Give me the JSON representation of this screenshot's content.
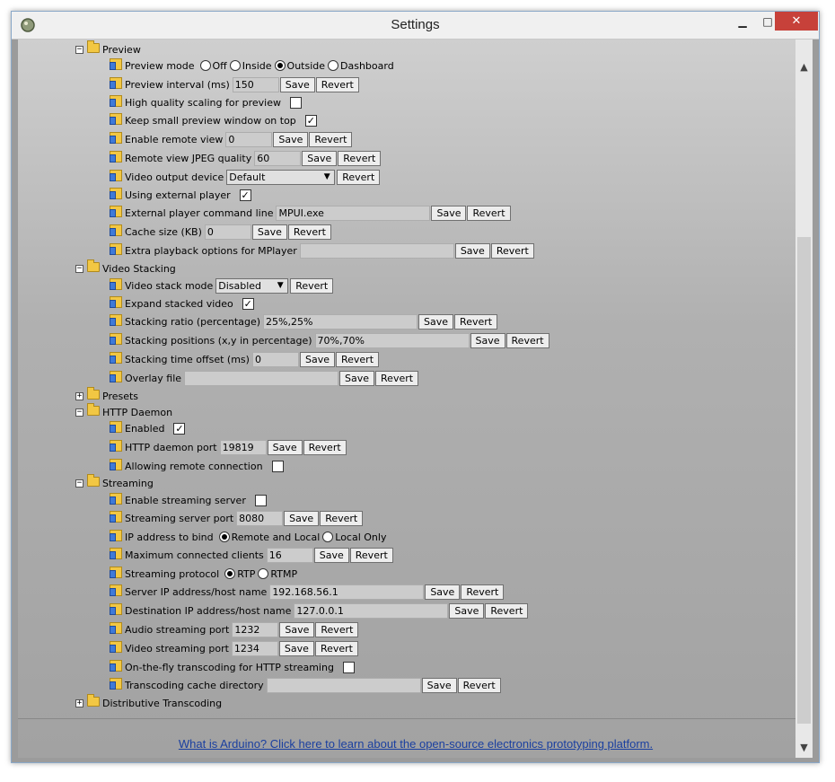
{
  "window": {
    "title": "Settings"
  },
  "sections": {
    "preview": {
      "label": "Preview",
      "preview_mode": {
        "label": "Preview mode",
        "options": [
          "Off",
          "Inside",
          "Outside",
          "Dashboard"
        ],
        "selected": "Outside"
      },
      "preview_interval": {
        "label": "Preview interval (ms)",
        "value": "150"
      },
      "high_quality_scaling": {
        "label": "High quality scaling for preview",
        "checked": false
      },
      "keep_small_preview": {
        "label": "Keep small preview window on top",
        "checked": true
      },
      "enable_remote_view": {
        "label": "Enable remote view",
        "value": "0"
      },
      "remote_view_jpeg": {
        "label": "Remote view JPEG quality",
        "value": "60"
      },
      "video_output_device": {
        "label": "Video output device",
        "value": "Default"
      },
      "using_external_player": {
        "label": "Using external player",
        "checked": true
      },
      "external_player_command": {
        "label": "External player command line",
        "value": "MPUI.exe"
      },
      "cache_size": {
        "label": "Cache size (KB)",
        "value": "0"
      },
      "extra_playback_options": {
        "label": "Extra playback options for MPlayer",
        "value": ""
      }
    },
    "video_stacking": {
      "label": "Video Stacking",
      "video_stack_mode": {
        "label": "Video stack mode",
        "value": "Disabled"
      },
      "expand_stacked_video": {
        "label": "Expand stacked video",
        "checked": true
      },
      "stacking_ratio": {
        "label": "Stacking ratio (percentage)",
        "value": "25%,25%"
      },
      "stacking_positions": {
        "label": "Stacking positions (x,y in percentage)",
        "value": "70%,70%"
      },
      "stacking_time_offset": {
        "label": "Stacking time offset (ms)",
        "value": "0"
      },
      "overlay_file": {
        "label": "Overlay file",
        "value": ""
      }
    },
    "presets": {
      "label": "Presets"
    },
    "http_daemon": {
      "label": "HTTP Daemon",
      "enabled": {
        "label": "Enabled",
        "checked": true
      },
      "http_daemon_port": {
        "label": "HTTP daemon port",
        "value": "19819"
      },
      "allowing_remote_connection": {
        "label": "Allowing remote connection",
        "checked": false
      }
    },
    "streaming": {
      "label": "Streaming",
      "enable_streaming_server": {
        "label": "Enable streaming server",
        "checked": false
      },
      "streaming_server_port": {
        "label": "Streaming server port",
        "value": "8080"
      },
      "ip_address_to_bind": {
        "label": "IP address to bind",
        "options": [
          "Remote and Local",
          "Local Only"
        ],
        "selected": "Remote and Local"
      },
      "maximum_connected_clients": {
        "label": "Maximum connected clients",
        "value": "16"
      },
      "streaming_protocol": {
        "label": "Streaming protocol",
        "options": [
          "RTP",
          "RTMP"
        ],
        "selected": "RTP"
      },
      "server_ip": {
        "label": "Server IP address/host name",
        "value": "192.168.56.1"
      },
      "destination_ip": {
        "label": "Destination IP address/host name",
        "value": "127.0.0.1"
      },
      "audio_streaming_port": {
        "label": "Audio streaming port",
        "value": "1232"
      },
      "video_streaming_port": {
        "label": "Video streaming port",
        "value": "1234"
      },
      "on_the_fly_transcoding": {
        "label": "On-the-fly transcoding for HTTP streaming",
        "checked": false
      },
      "transcoding_cache_directory": {
        "label": "Transcoding cache directory",
        "value": ""
      }
    },
    "distributive_transcoding": {
      "label": "Distributive Transcoding"
    }
  },
  "buttons": {
    "save": "Save",
    "revert": "Revert"
  },
  "toggles": {
    "expanded": "−",
    "collapsed": "+"
  },
  "footer_link": "What is Arduino? Click here to learn about the open-source electronics prototyping platform.",
  "icons": {
    "expand": "plus-box-icon",
    "collapse": "minus-box-icon",
    "folder": "folder-icon",
    "setting": "setting-item-icon"
  }
}
